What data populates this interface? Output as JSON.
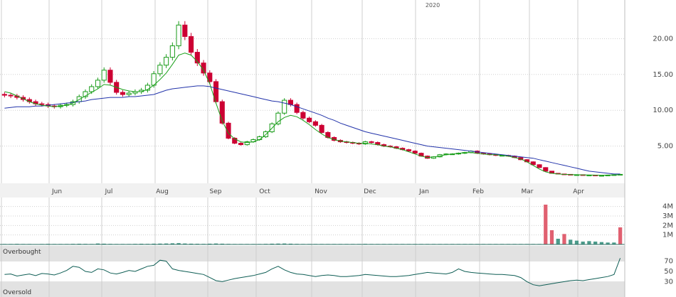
{
  "colors": {
    "up": "#1a9c1a",
    "down": "#cc0033",
    "ma_short": "#1aa01a",
    "ma_long": "#2233aa",
    "rsi": "#0f5e55",
    "volume": "#4a9a8a",
    "volume_spike": "#e06070",
    "grid": "#cfcfcf",
    "band": "#e2e2e2",
    "text": "#555555"
  },
  "chart_data": [
    {
      "type": "candlestick",
      "year_label": "2020",
      "x_labels": [
        "Jun",
        "Jul",
        "Aug",
        "Sep",
        "Oct",
        "Nov",
        "Dec",
        "Jan",
        "Feb",
        "Mar",
        "Apr"
      ],
      "y_ticks": [
        "20.00",
        "15.00",
        "10.00",
        "5.00"
      ],
      "y_tick_values": [
        20,
        15,
        10,
        5
      ],
      "ylim": [
        0,
        25
      ],
      "grid": true,
      "series": [
        {
          "values": [
            12.1,
            12.0,
            11.8,
            11.5,
            11.2,
            10.9,
            10.8,
            10.6,
            10.5,
            10.7,
            10.8,
            11.2,
            11.9,
            12.6,
            13.3,
            14.2,
            15.6,
            13.9,
            12.5,
            12.2,
            12.4,
            12.6,
            12.8,
            13.5,
            15.1,
            16.3,
            17.4,
            19.0,
            21.9,
            20.3,
            18.1,
            16.6,
            15.2,
            14.0,
            11.2,
            8.2,
            6.1,
            5.4,
            5.2,
            5.6,
            5.9,
            6.3,
            7.0,
            8.1,
            9.6,
            11.4,
            10.8,
            9.7,
            8.9,
            8.4,
            7.9,
            6.9,
            6.2,
            5.8,
            5.6,
            5.5,
            5.4,
            5.3,
            5.6,
            5.5,
            5.2,
            5.0,
            4.9,
            4.7,
            4.5,
            4.3,
            4.0,
            3.6,
            3.3,
            3.5,
            3.8,
            3.9,
            3.9,
            4.0,
            4.1,
            4.3,
            4.0,
            3.9,
            3.8,
            3.7,
            3.7,
            3.6,
            3.4,
            3.1,
            2.8,
            2.4,
            2.0,
            1.5,
            1.2,
            1.1,
            1.05,
            1.0,
            1.0,
            0.95,
            0.95,
            0.9,
            0.9,
            0.95,
            1.0,
            1.05
          ],
          "ma_short": [
            12.6,
            12.4,
            12.0,
            11.6,
            11.2,
            10.9,
            10.7,
            10.6,
            10.5,
            10.6,
            10.7,
            11.0,
            11.5,
            12.0,
            12.5,
            13.0,
            13.6,
            13.5,
            13.2,
            12.9,
            12.7,
            12.6,
            12.6,
            12.9,
            13.5,
            14.3,
            15.2,
            16.4,
            17.7,
            18.0,
            17.7,
            16.8,
            15.6,
            13.7,
            11.0,
            8.5,
            6.8,
            6.0,
            5.6,
            5.5,
            5.6,
            5.9,
            6.6,
            7.5,
            8.4,
            9.0,
            9.3,
            9.1,
            8.6,
            8.0,
            7.3,
            6.7,
            6.2,
            5.9,
            5.7,
            5.6,
            5.5,
            5.4,
            5.4,
            5.3,
            5.2,
            5.0,
            4.9,
            4.7,
            4.5,
            4.2,
            3.9,
            3.6,
            3.4,
            3.5,
            3.6,
            3.8,
            3.9,
            4.0,
            4.1,
            4.1,
            4.0,
            3.9,
            3.8,
            3.8,
            3.7,
            3.6,
            3.4,
            3.2,
            2.8,
            2.3,
            1.8,
            1.4,
            1.2,
            1.1,
            1.05,
            1.02,
            1.0,
            0.98,
            0.96,
            0.94,
            0.93,
            0.95,
            0.98,
            1.0
          ],
          "ma_long": [
            10.3,
            10.4,
            10.5,
            10.5,
            10.5,
            10.6,
            10.6,
            10.7,
            10.8,
            10.9,
            11.0,
            11.1,
            11.2,
            11.3,
            11.5,
            11.6,
            11.7,
            11.8,
            11.8,
            11.8,
            11.9,
            11.9,
            12.0,
            12.1,
            12.2,
            12.5,
            12.8,
            13.0,
            13.1,
            13.2,
            13.3,
            13.4,
            13.4,
            13.3,
            13.1,
            12.9,
            12.7,
            12.5,
            12.3,
            12.1,
            11.9,
            11.7,
            11.5,
            11.3,
            11.2,
            11.0,
            10.8,
            10.5,
            10.2,
            9.9,
            9.6,
            9.3,
            8.9,
            8.6,
            8.2,
            7.9,
            7.6,
            7.3,
            7.0,
            6.8,
            6.6,
            6.4,
            6.2,
            6.0,
            5.8,
            5.6,
            5.4,
            5.2,
            5.0,
            4.9,
            4.8,
            4.7,
            4.6,
            4.5,
            4.4,
            4.3,
            4.2,
            4.1,
            4.0,
            3.9,
            3.8,
            3.7,
            3.6,
            3.5,
            3.4,
            3.3,
            3.1,
            2.9,
            2.7,
            2.5,
            2.3,
            2.1,
            1.9,
            1.7,
            1.5,
            1.4,
            1.3,
            1.2,
            1.1,
            1.1
          ]
        }
      ]
    },
    {
      "type": "bar",
      "y_ticks": [
        "4M",
        "3M",
        "2M",
        "1M"
      ],
      "y_tick_values": [
        4,
        3,
        2,
        1
      ],
      "ylim": [
        0,
        4.8
      ],
      "values": [
        0.05,
        0.05,
        0.06,
        0.05,
        0.05,
        0.04,
        0.05,
        0.06,
        0.05,
        0.05,
        0.05,
        0.06,
        0.07,
        0.06,
        0.05,
        0.1,
        0.08,
        0.06,
        0.05,
        0.05,
        0.05,
        0.06,
        0.07,
        0.06,
        0.08,
        0.09,
        0.1,
        0.12,
        0.14,
        0.1,
        0.08,
        0.07,
        0.06,
        0.08,
        0.1,
        0.08,
        0.06,
        0.05,
        0.05,
        0.05,
        0.05,
        0.05,
        0.06,
        0.08,
        0.09,
        0.1,
        0.08,
        0.06,
        0.05,
        0.05,
        0.05,
        0.05,
        0.05,
        0.05,
        0.05,
        0.05,
        0.05,
        0.05,
        0.06,
        0.05,
        0.05,
        0.05,
        0.05,
        0.05,
        0.05,
        0.05,
        0.05,
        0.05,
        0.05,
        0.05,
        0.05,
        0.05,
        0.05,
        0.05,
        0.05,
        0.05,
        0.05,
        0.05,
        0.05,
        0.05,
        0.05,
        0.05,
        0.05,
        0.05,
        0.05,
        0.05,
        0.05,
        4.2,
        1.5,
        0.6,
        1.1,
        0.5,
        0.4,
        0.3,
        0.35,
        0.3,
        0.25,
        0.2,
        0.2,
        1.8
      ]
    },
    {
      "type": "line",
      "label_top": "Overbought",
      "label_bottom": "Oversold",
      "y_ticks": [
        "70",
        "50",
        "30"
      ],
      "y_tick_values": [
        70,
        50,
        30
      ],
      "ylim": [
        0,
        100
      ],
      "values": [
        44,
        45,
        41,
        43,
        45,
        42,
        46,
        45,
        43,
        47,
        52,
        60,
        58,
        50,
        48,
        55,
        53,
        47,
        45,
        48,
        52,
        50,
        55,
        60,
        62,
        72,
        70,
        55,
        52,
        50,
        48,
        46,
        44,
        38,
        32,
        30,
        33,
        36,
        38,
        40,
        42,
        45,
        48,
        55,
        60,
        53,
        48,
        45,
        44,
        42,
        40,
        42,
        43,
        42,
        40,
        40,
        41,
        42,
        44,
        43,
        42,
        41,
        40,
        40,
        41,
        42,
        44,
        46,
        48,
        47,
        46,
        45,
        48,
        55,
        50,
        48,
        47,
        46,
        45,
        44,
        44,
        43,
        42,
        38,
        30,
        24,
        22,
        24,
        26,
        28,
        30,
        32,
        33,
        32,
        34,
        36,
        38,
        40,
        44,
        76
      ]
    }
  ]
}
